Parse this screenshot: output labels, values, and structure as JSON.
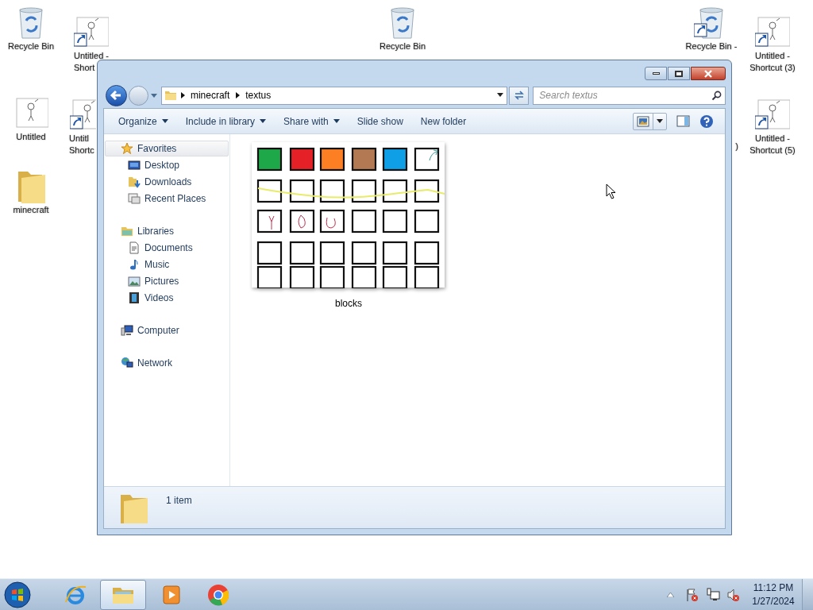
{
  "desktop": {
    "icons": [
      {
        "kind": "recycle-bin",
        "lines": [
          "Recycle Bin"
        ]
      },
      {
        "kind": "shortcut",
        "lines": [
          "Untitled -",
          "Short"
        ]
      },
      {
        "kind": "image",
        "lines": [
          "Untitled"
        ]
      },
      {
        "kind": "shortcut",
        "lines": [
          "Untitl",
          "Shortc"
        ]
      },
      {
        "kind": "folder",
        "lines": [
          "minecraft"
        ]
      },
      {
        "kind": "recycle-bin",
        "lines": [
          "Recycle Bin"
        ]
      },
      {
        "kind": "recycle-shortcut",
        "lines": [
          "Recycle Bin -"
        ]
      },
      {
        "kind": "shortcut",
        "lines": [
          "Untitled -",
          "Shortcut (3)"
        ]
      },
      {
        "kind": "hidden",
        "lines": [
          ")"
        ]
      },
      {
        "kind": "shortcut",
        "lines": [
          "Untitled -",
          "Shortcut (5)"
        ]
      }
    ]
  },
  "window": {
    "breadcrumb": [
      "minecraft",
      "textus"
    ],
    "search": {
      "placeholder": "Search textus"
    },
    "toolbar": [
      {
        "label": "Organize",
        "dropdown": true
      },
      {
        "label": "Include in library",
        "dropdown": true
      },
      {
        "label": "Share with",
        "dropdown": true
      },
      {
        "label": "Slide show",
        "dropdown": false
      },
      {
        "label": "New folder",
        "dropdown": false
      }
    ],
    "nav_pane": [
      {
        "label": "Favorites",
        "selected": true,
        "children": [
          {
            "label": "Desktop"
          },
          {
            "label": "Downloads"
          },
          {
            "label": "Recent Places"
          }
        ]
      },
      {
        "label": "Libraries",
        "selected": false,
        "children": [
          {
            "label": "Documents"
          },
          {
            "label": "Music"
          },
          {
            "label": "Pictures"
          },
          {
            "label": "Videos"
          }
        ]
      },
      {
        "label": "Computer",
        "selected": false
      },
      {
        "label": "Network",
        "selected": false
      }
    ],
    "files": [
      {
        "name": "blocks"
      }
    ],
    "details": {
      "count": "1 item"
    }
  },
  "taskbar": {
    "items": [
      {
        "kind": "ie",
        "selected": false
      },
      {
        "kind": "explorer",
        "selected": true
      },
      {
        "kind": "media",
        "selected": false
      },
      {
        "kind": "chrome",
        "selected": false
      }
    ],
    "clock": {
      "time": "11:12 PM",
      "date": "1/27/2024"
    }
  }
}
